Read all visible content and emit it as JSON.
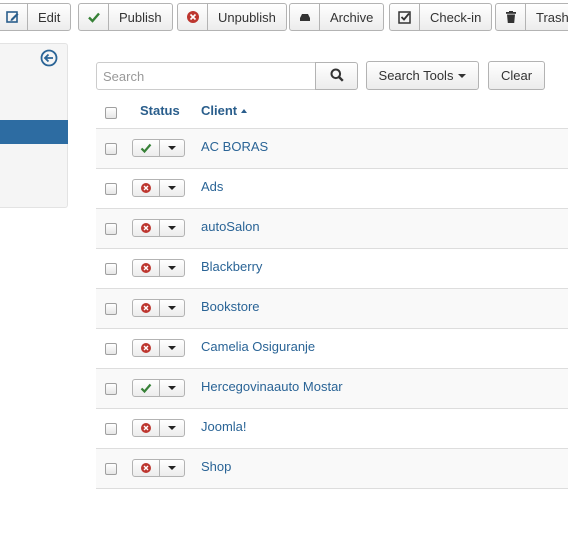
{
  "toolbar": {
    "buttons": [
      {
        "label": "Edit",
        "icon": "edit-icon"
      },
      {
        "label": "Publish",
        "icon": "check-icon"
      },
      {
        "label": "Unpublish",
        "icon": "unpublish-icon"
      },
      {
        "label": "Archive",
        "icon": "archive-icon"
      },
      {
        "label": "Check-in",
        "icon": "checkbox-icon"
      },
      {
        "label": "Trash",
        "icon": "trash-icon"
      }
    ]
  },
  "search": {
    "placeholder": "Search",
    "search_tools_label": "Search Tools",
    "clear_label": "Clear"
  },
  "table": {
    "headers": {
      "status": "Status",
      "client": "Client"
    },
    "rows": [
      {
        "client": "AC BORAS",
        "published": true
      },
      {
        "client": "Ads",
        "published": false
      },
      {
        "client": "autoSalon",
        "published": false
      },
      {
        "client": "Blackberry",
        "published": false
      },
      {
        "client": "Bookstore",
        "published": false
      },
      {
        "client": "Camelia Osiguranje",
        "published": false
      },
      {
        "client": "Hercegovinaauto Mostar",
        "published": true
      },
      {
        "client": "Joomla!",
        "published": false
      },
      {
        "client": "Shop",
        "published": false
      }
    ]
  },
  "colors": {
    "link": "#2a6496",
    "header": "#2a5e8c",
    "published": "#378137",
    "unpublished": "#bd362f",
    "sidebar_active": "#2d6ca2"
  }
}
